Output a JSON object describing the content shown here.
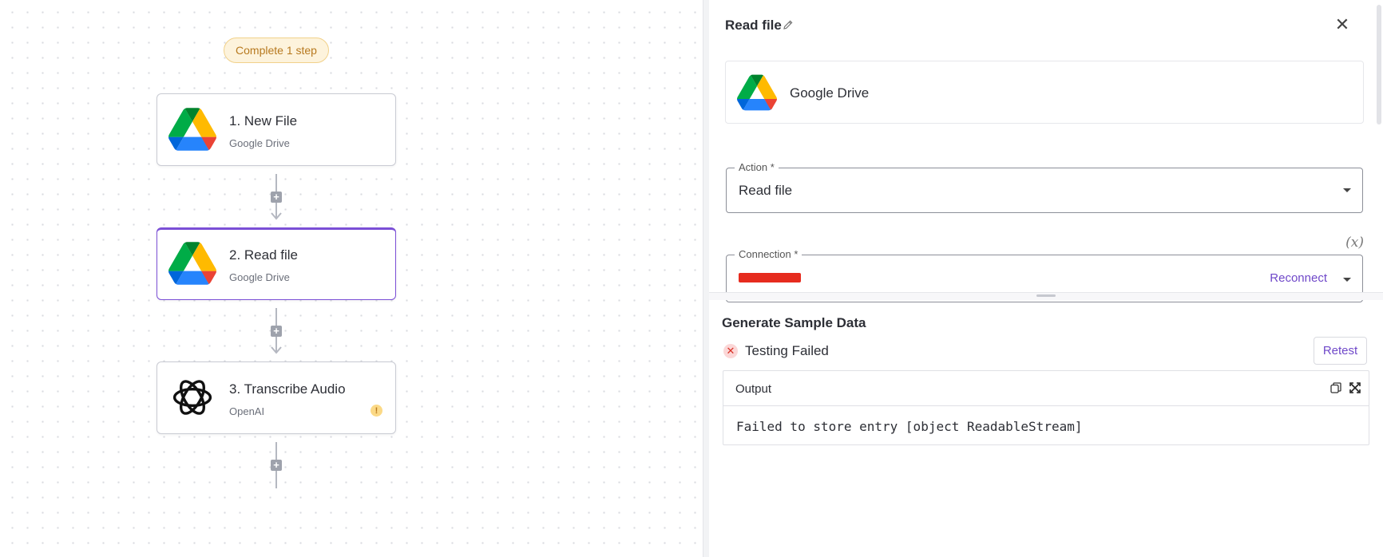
{
  "canvas": {
    "step_pill": "Complete 1 step",
    "nodes": [
      {
        "title": "1. New File",
        "app": "Google Drive",
        "icon": "google-drive-icon"
      },
      {
        "title": "2. Read file",
        "app": "Google Drive",
        "icon": "google-drive-icon"
      },
      {
        "title": "3. Transcribe Audio",
        "app": "OpenAI",
        "icon": "openai-icon",
        "warning": "!"
      }
    ],
    "add_step_symbol": "+"
  },
  "panel": {
    "title": "Read file",
    "close_symbol": "✕",
    "piece": {
      "name": "Google Drive",
      "icon": "google-drive-icon"
    },
    "action": {
      "label": "Action *",
      "value": "Read file"
    },
    "connection": {
      "label": "Connection *",
      "reconnect_label": "Reconnect"
    },
    "fx_label": "(x)",
    "sample": {
      "title": "Generate Sample Data",
      "status": "Testing Failed",
      "status_symbol": "✕",
      "retest_label": "Retest",
      "output_label": "Output",
      "output_text": "Failed to store entry [object ReadableStream]"
    }
  },
  "colors": {
    "accent": "#6f48c9",
    "active_border": "#7b4fd6",
    "warning_bg": "#fdf3dc",
    "error": "#d93025"
  }
}
